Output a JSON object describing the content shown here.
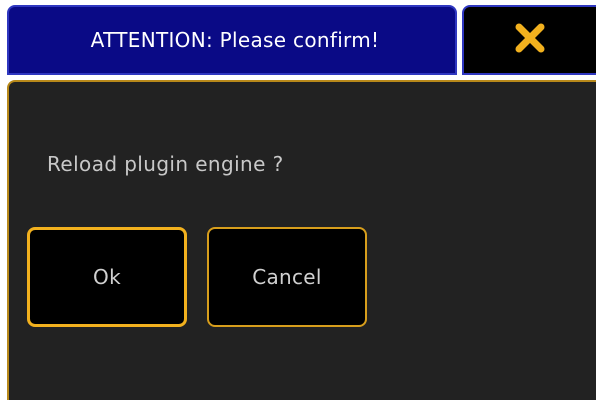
{
  "dialog": {
    "title": "ATTENTION: Please confirm!",
    "message": "Reload plugin engine ?",
    "close_icon": "close-x-icon",
    "buttons": {
      "ok_label": "Ok",
      "cancel_label": "Cancel"
    }
  },
  "colors": {
    "title_bar_bg": "#0a0a86",
    "title_bar_border": "#2f37c0",
    "dialog_bg": "#222222",
    "accent_border": "#f2b11e",
    "close_icon": "#f2b11e"
  }
}
